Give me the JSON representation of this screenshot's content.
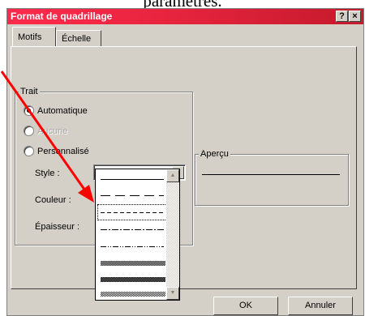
{
  "page": {
    "caption": "paramètres."
  },
  "dialog": {
    "title": "Format de quadrillage",
    "help_label": "?",
    "close_label": "×",
    "tabs": [
      {
        "label": "Motifs",
        "active": true
      },
      {
        "label": "Échelle",
        "active": false
      }
    ],
    "trait": {
      "label": "Trait",
      "options": [
        {
          "label": "Automatique",
          "checked": true,
          "enabled": true
        },
        {
          "label": "Aucune",
          "checked": false,
          "enabled": false
        },
        {
          "label": "Personnalisé",
          "checked": false,
          "enabled": true
        }
      ],
      "style_label": "Style :",
      "couleur_label": "Couleur :",
      "epaisseur_label": "Épaisseur :"
    },
    "apercu": {
      "label": "Aperçu"
    },
    "style_options": [
      "solid",
      "long-dash",
      "dashed",
      "dash-dot",
      "dash-dot-dot",
      "gray-25",
      "gray-50",
      "gray-75"
    ],
    "selected_style": "dashed",
    "buttons": {
      "ok": "OK",
      "cancel": "Annuler"
    },
    "colors": {
      "titlebar": "#e7243e",
      "face": "#d4d0c8",
      "annotation_arrow": "#ff0000"
    }
  }
}
